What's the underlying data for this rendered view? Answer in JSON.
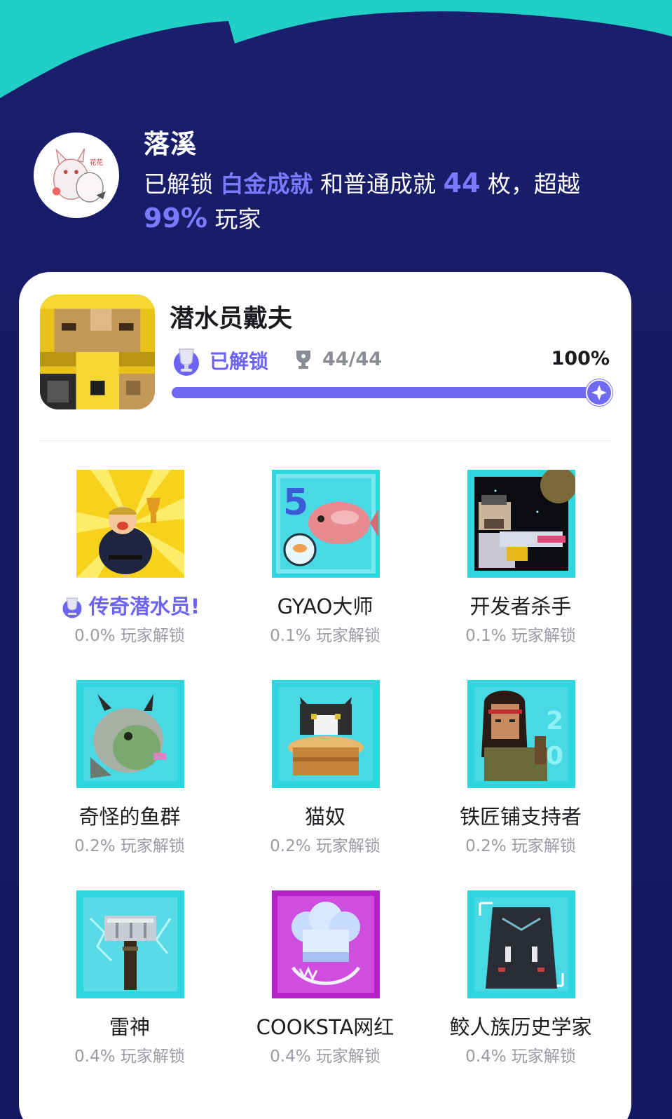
{
  "header": {
    "colors": {
      "background": "#141a63",
      "wave": "#22cfc6",
      "accent": "#7b79ff"
    }
  },
  "profile": {
    "name": "落溪",
    "summary_prefix": "已解锁",
    "platinum": "白金成就",
    "summary_mid": "和普通成就",
    "count": "44",
    "summary_suffix": "枚，超越",
    "beat_percent": "99%",
    "summary_end": "玩家",
    "avatar_icon": "cat-avatar-icon"
  },
  "game": {
    "title": "潜水员戴夫",
    "icon": "dave-game-icon",
    "status": "已解锁",
    "trophy_icon": "trophy-icon",
    "trophies": "44/44",
    "percent": "100%",
    "progress": 1.0
  },
  "achievements": [
    {
      "name": "传奇潜水员!",
      "rate": "0.0% 玩家解锁",
      "rare": true,
      "icon": "legendary-diver-icon"
    },
    {
      "name": "GYAO大师",
      "rate": "0.1% 玩家解锁",
      "rare": false,
      "icon": "fish-5-icon"
    },
    {
      "name": "开发者杀手",
      "rate": "0.1% 玩家解锁",
      "rare": false,
      "icon": "space-gun-icon"
    },
    {
      "name": "奇怪的鱼群",
      "rate": "0.2% 玩家解锁",
      "rare": false,
      "icon": "dragon-fish-icon"
    },
    {
      "name": "猫奴",
      "rate": "0.2% 玩家解锁",
      "rare": false,
      "icon": "cat-icon"
    },
    {
      "name": "铁匠铺支持者",
      "rate": "0.2% 玩家解锁",
      "rare": false,
      "icon": "warrior-icon"
    },
    {
      "name": "雷神",
      "rate": "0.4% 玩家解锁",
      "rare": false,
      "icon": "hammer-icon"
    },
    {
      "name": "COOKSTA网红",
      "rate": "0.4% 玩家解锁",
      "rare": false,
      "icon": "chef-hat-icon"
    },
    {
      "name": "鲛人族历史学家",
      "rate": "0.4% 玩家解锁",
      "rare": false,
      "icon": "dark-tablet-icon"
    }
  ]
}
